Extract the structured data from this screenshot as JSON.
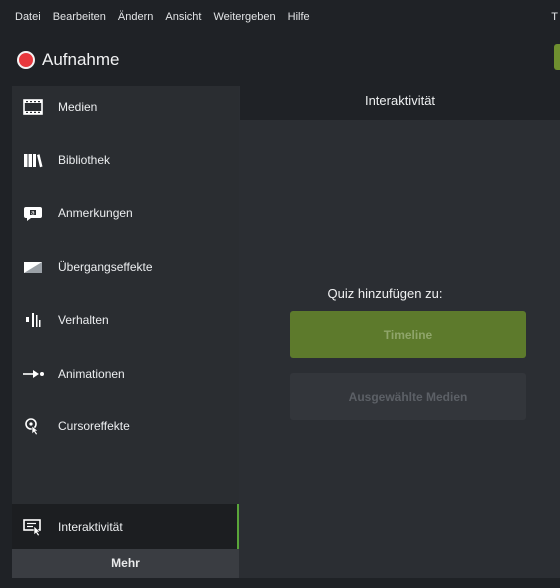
{
  "menu": {
    "items": [
      "Datei",
      "Bearbeiten",
      "Ändern",
      "Ansicht",
      "Weitergeben",
      "Hilfe"
    ],
    "cutoff": "T"
  },
  "recorder": {
    "label": "Aufnahme",
    "dot_color": "#e8383d"
  },
  "sidebar": {
    "items": [
      {
        "label": "Medien",
        "icon": "film-strip-icon"
      },
      {
        "label": "Bibliothek",
        "icon": "library-books-icon"
      },
      {
        "label": "Anmerkungen",
        "icon": "annotation-callout-icon"
      },
      {
        "label": "Übergangseffekte",
        "icon": "transition-icon"
      },
      {
        "label": "Verhalten",
        "icon": "behavior-bars-icon"
      },
      {
        "label": "Animationen",
        "icon": "animation-arrow-icon"
      },
      {
        "label": "Cursoreffekte",
        "icon": "cursor-effect-icon"
      }
    ],
    "active_item": {
      "label": "Interaktivität",
      "icon": "interactivity-icon"
    },
    "more_label": "Mehr",
    "accent_color": "#5aa53a"
  },
  "panel": {
    "title": "Interaktivität",
    "quiz_prompt": "Quiz hinzufügen zu:",
    "timeline_button": "Timeline",
    "selected_media_button": "Ausgewählte Medien"
  }
}
